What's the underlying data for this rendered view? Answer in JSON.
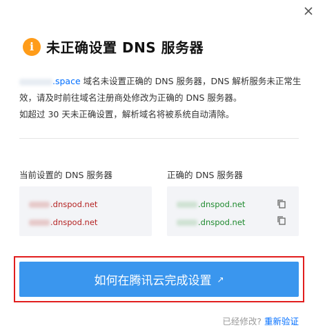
{
  "dialog": {
    "title": "未正确设置 DNS 服务器",
    "info_icon_char": "i",
    "description": {
      "domain_suffix": ".space",
      "line1_rest": " 域名未设置正确的 DNS 服务器，DNS 解析服务未正常生效，请及时前往域名注册商处修改为正确的 DNS 服务器。",
      "line2": "如超过 30 天未正确设置，解析域名将被系统自动清除。"
    },
    "current": {
      "label": "当前设置的 DNS 服务器",
      "servers": [
        ".dnspod.net",
        ".dnspod.net"
      ]
    },
    "correct": {
      "label": "正确的 DNS 服务器",
      "servers": [
        ".dnspod.net",
        ".dnspod.net"
      ]
    },
    "cta": {
      "label": "如何在腾讯云完成设置",
      "ext_icon": "↗"
    },
    "footer": {
      "question": "已经修改?",
      "link": "重新验证"
    }
  },
  "colors": {
    "accent": "#3a96ee",
    "warning_icon": "#ff9c19",
    "link": "#006eff",
    "current_server_text": "#b52323",
    "correct_server_text": "#1e8a2e",
    "highlight_frame": "#e11d1d"
  },
  "icons": {
    "close": "close-icon",
    "info": "info-icon",
    "copy": "copy-icon",
    "external": "external-link-icon"
  }
}
